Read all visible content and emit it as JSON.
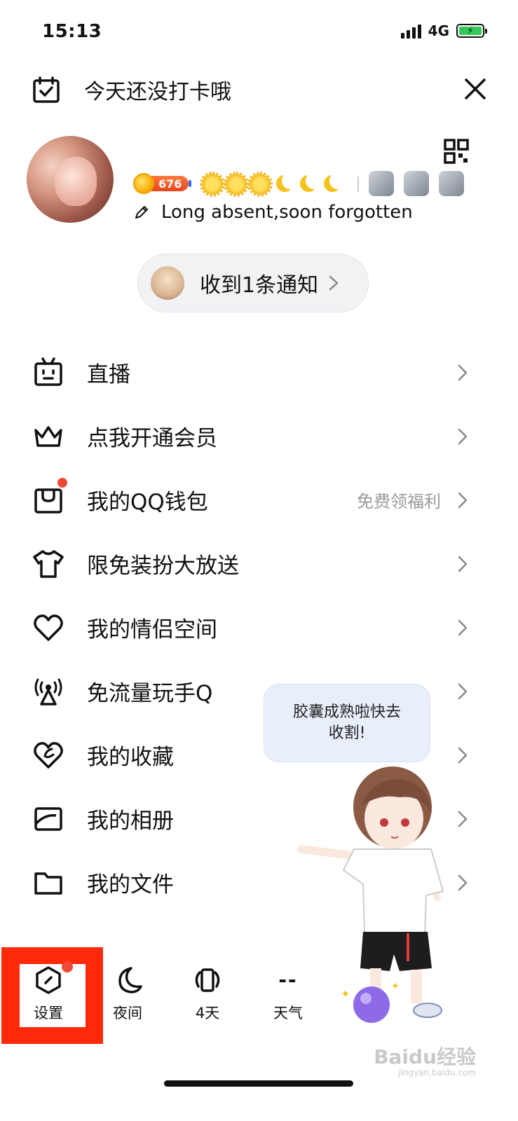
{
  "status_bar": {
    "time": "15:13",
    "network": "4G"
  },
  "header": {
    "checkin_text": "今天还没打卡哦"
  },
  "profile": {
    "coins": "676",
    "signature": "Long absent,soon forgotten"
  },
  "notification": {
    "text": "收到1条通知"
  },
  "menu": {
    "items": [
      {
        "label": "直播",
        "sub": ""
      },
      {
        "label": "点我开通会员",
        "sub": ""
      },
      {
        "label": "我的QQ钱包",
        "sub": "免费领福利"
      },
      {
        "label": "限免装扮大放送",
        "sub": ""
      },
      {
        "label": "我的情侣空间",
        "sub": ""
      },
      {
        "label": "免流量玩手Q",
        "sub": ""
      },
      {
        "label": "我的收藏",
        "sub": ""
      },
      {
        "label": "我的相册",
        "sub": ""
      },
      {
        "label": "我的文件",
        "sub": ""
      }
    ]
  },
  "bubble": {
    "line1": "胶囊成熟啦快去",
    "line2": "收割!"
  },
  "bottom_bar": {
    "settings": "设置",
    "night": "夜间",
    "days": "4天",
    "weather_value": "--",
    "weather": "天气"
  },
  "watermark": {
    "brand": "Baidu经验",
    "url": "jingyan.baidu.com"
  },
  "colors": {
    "accent_red": "#ff2a0a",
    "badge_dot": "#f04a37",
    "battery_green": "#34c759"
  }
}
